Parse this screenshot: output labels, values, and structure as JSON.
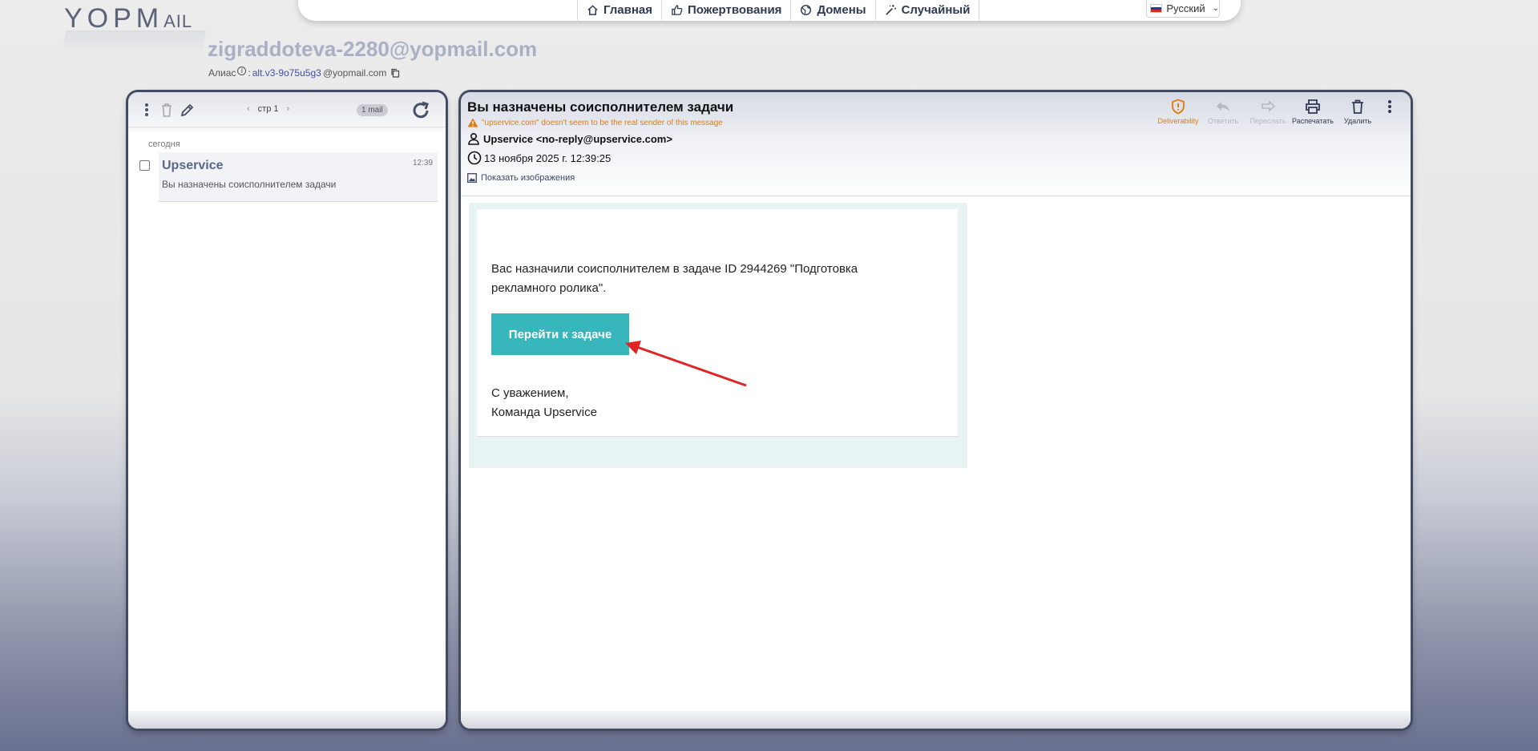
{
  "brand": {
    "logo_big": "YOPM",
    "logo_small": "AIL"
  },
  "nav": {
    "items": [
      {
        "label": "Главная",
        "icon": "home-icon"
      },
      {
        "label": "Пожертвования",
        "icon": "thumbs-up-icon"
      },
      {
        "label": "Домены",
        "icon": "globe-icon"
      },
      {
        "label": "Случайный",
        "icon": "magic-wand-icon"
      }
    ],
    "language": "Русский"
  },
  "mailbox": {
    "address": "zigraddoteva-2280@yopmail.com",
    "alias_label": "Алиас",
    "alias_colon": ":",
    "alias_value": "alt.v3-9o75u5g3",
    "alias_domain": "@yopmail.com"
  },
  "inbox": {
    "page_label": "стр 1",
    "count_badge": "1 mail",
    "day_label": "сегодня",
    "messages": [
      {
        "from": "Upservice",
        "subject": "Вы назначены соисполнителем задачи",
        "time": "12:39"
      }
    ]
  },
  "message": {
    "subject": "Вы назначены соисполнителем задачи",
    "warning": "\"upservice.com\" doesn't seem to be the real sender of this message",
    "sender": "Upservice <no-reply@upservice.com>",
    "date": "13 ноября 2025 г. 12:39:25",
    "show_images": "Показать изображения",
    "actions": [
      {
        "label": "Deliverability",
        "icon": "shield-alert-icon",
        "state": "warning"
      },
      {
        "label": "Ответить",
        "icon": "reply-icon",
        "state": "disabled"
      },
      {
        "label": "Переслать",
        "icon": "forward-icon",
        "state": "disabled"
      },
      {
        "label": "Распечатать",
        "icon": "print-icon",
        "state": "enabled"
      },
      {
        "label": "Удалить",
        "icon": "trash-icon",
        "state": "enabled"
      }
    ],
    "body": {
      "text": "Вас назначили соисполнителем в задаче ID 2944269 \"Подготовка рекламного ролика\".",
      "button_label": "Перейти к задаче",
      "button_color": "#37b6bb",
      "sign_line1": "С уважением,",
      "sign_line2": "Команда Upservice"
    }
  },
  "colors": {
    "accent": "#37b6bb",
    "warning": "#e07d10",
    "annotation_arrow": "#e02424"
  }
}
